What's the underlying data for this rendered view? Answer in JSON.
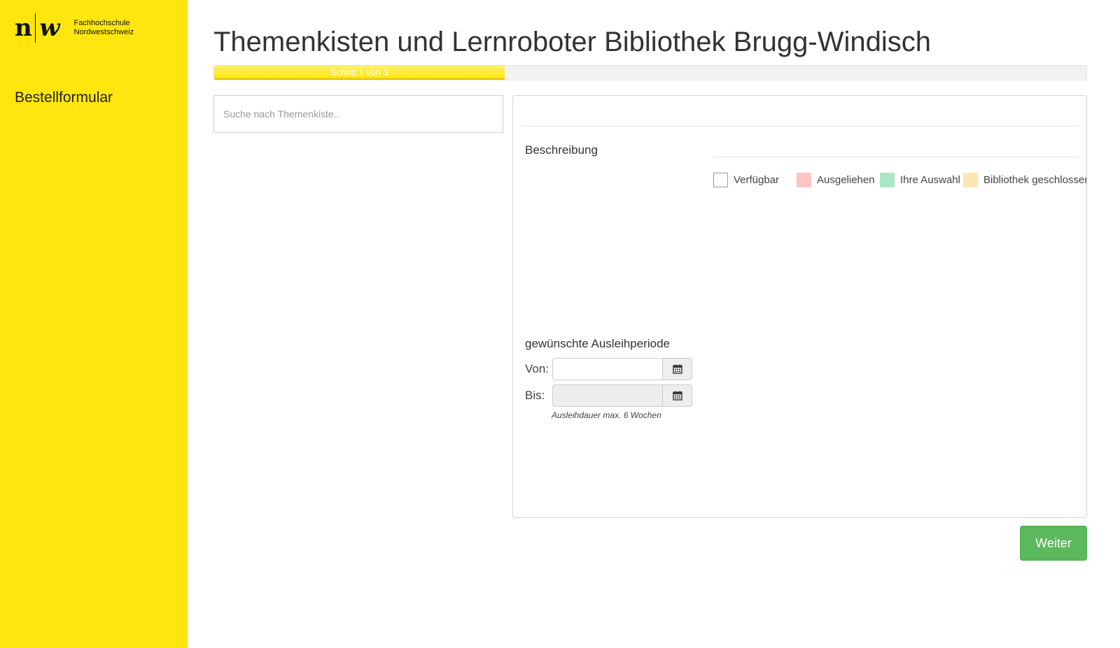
{
  "sidebar": {
    "logo": {
      "mark_left": "n",
      "mark_right": "w",
      "line1": "Fachhochschule",
      "line2": "Nordwestschweiz"
    },
    "title": "Bestellformular",
    "background_color": "#ffe60f"
  },
  "header": {
    "title": "Themenkisten und Lernroboter Bibliothek Brugg-Windisch"
  },
  "progress": {
    "label": "Schritt 1 von 3",
    "percent": 33.3,
    "color": "#ffe60f"
  },
  "search": {
    "placeholder": "Suche nach Themenkiste..",
    "value": ""
  },
  "details": {
    "description_heading": "Beschreibung",
    "legend": [
      {
        "label": "Verfügbar",
        "color": "#ffffff"
      },
      {
        "label": "Ausgeliehen",
        "color": "#ffc4c4"
      },
      {
        "label": "Ihre Auswahl",
        "color": "#a8e6c6"
      },
      {
        "label": "Bibliothek geschlossen",
        "color": "#ffe6b0"
      }
    ],
    "period": {
      "heading": "gewünschte Ausleihperiode",
      "from_label": "Von:",
      "from_value": "",
      "to_label": "Bis:",
      "to_value": "",
      "calendar_icon": "calendar-icon",
      "hint": "Ausleihdauer max. 6 Wochen"
    }
  },
  "actions": {
    "next_label": "Weiter",
    "next_color": "#5cb85c"
  }
}
